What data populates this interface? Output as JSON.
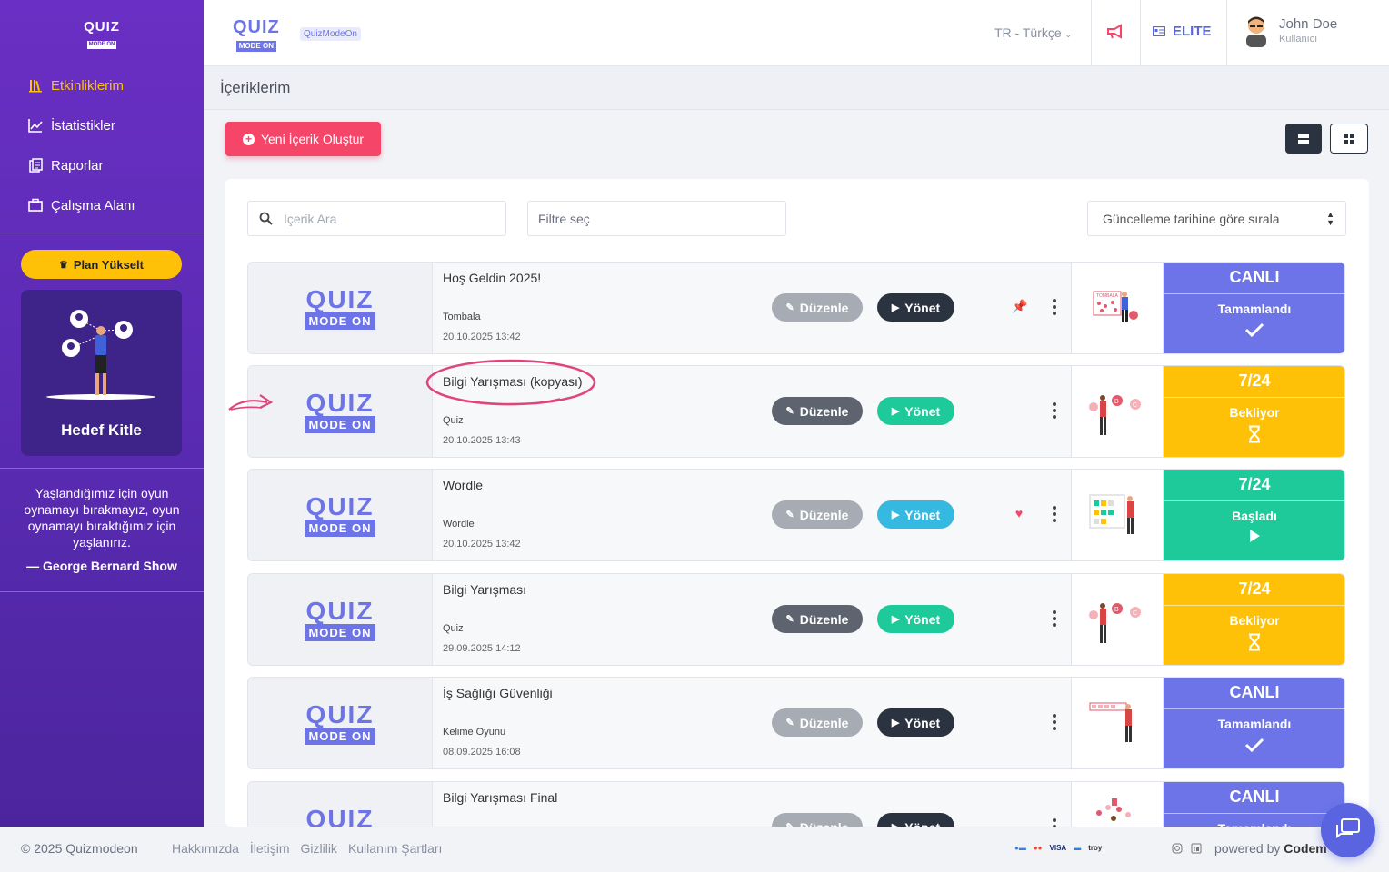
{
  "sidebar": {
    "logo": {
      "quiz": "QUIZ",
      "modeon": "MODE ON"
    },
    "items": [
      {
        "label": "Etkinliklerim",
        "icon": "library-icon",
        "active": true
      },
      {
        "label": "İstatistikler",
        "icon": "chart-line-icon"
      },
      {
        "label": "Raporlar",
        "icon": "reports-icon"
      },
      {
        "label": "Çalışma Alanı",
        "icon": "briefcase-icon"
      }
    ],
    "plan_button": "Plan Yükselt",
    "audience_card": "Hedef Kitle",
    "quote": "Yaşlandığımız için oyun oynamayı bırakmayız, oyun oynamayı bıraktığımız için yaşlanırız.",
    "quote_author": "— George Bernard Show"
  },
  "header": {
    "logo": {
      "quiz": "QUIZ",
      "modeon": "MODE ON"
    },
    "badge": "QuizModeOn",
    "language": "TR - Türkçe",
    "plan": "ELITE",
    "user_name": "John Doe",
    "user_role": "Kullanıcı"
  },
  "page_title": "İçeriklerim",
  "new_content_button": "Yeni İçerik Oluştur",
  "toolbar": {
    "search_placeholder": "İçerik Ara",
    "filter_placeholder": "Filtre seç",
    "sort_label": "Güncelleme tarihine göre sırala"
  },
  "colors": {
    "purple": "#6c74e8",
    "yellow": "#ffc107",
    "green": "#1ec99a",
    "pink": "#f5466a",
    "blue": "#5a63e0"
  },
  "rows": [
    {
      "title": "Hoş Geldin 2025!",
      "type": "Tombala",
      "date": "20.10.2025 13:42",
      "edit_label": "Düzenle",
      "manage_label": "Yönet",
      "edit_style": "gray",
      "manage_style": "dark",
      "mark": "pin",
      "status_top": "CANLI",
      "status_label": "Tamamlandı",
      "status_icon": "check",
      "status_color": "#6c74e8"
    },
    {
      "title": "Bilgi Yarışması (kopyası)",
      "type": "Quiz",
      "date": "20.10.2025 13:43",
      "edit_label": "Düzenle",
      "manage_label": "Yönet",
      "edit_style": "dark-gray",
      "manage_style": "green",
      "mark": "",
      "status_top": "7/24",
      "status_label": "Bekliyor",
      "status_icon": "hourglass",
      "status_color": "#ffc107"
    },
    {
      "title": "Wordle",
      "type": "Wordle",
      "date": "20.10.2025 13:42",
      "edit_label": "Düzenle",
      "manage_label": "Yönet",
      "edit_style": "gray",
      "manage_style": "cyan",
      "mark": "heart",
      "status_top": "7/24",
      "status_label": "Başladı",
      "status_icon": "play",
      "status_color": "#1ec99a"
    },
    {
      "title": "Bilgi Yarışması",
      "type": "Quiz",
      "date": "29.09.2025 14:12",
      "edit_label": "Düzenle",
      "manage_label": "Yönet",
      "edit_style": "dark-gray",
      "manage_style": "green",
      "mark": "",
      "status_top": "7/24",
      "status_label": "Bekliyor",
      "status_icon": "hourglass",
      "status_color": "#ffc107"
    },
    {
      "title": "İş Sağlığı Güvenliği",
      "type": "Kelime Oyunu",
      "date": "08.09.2025 16:08",
      "edit_label": "Düzenle",
      "manage_label": "Yönet",
      "edit_style": "gray",
      "manage_style": "dark",
      "mark": "",
      "status_top": "CANLI",
      "status_label": "Tamamlandı",
      "status_icon": "check",
      "status_color": "#6c74e8"
    },
    {
      "title": "Bilgi Yarışması Final",
      "type": "",
      "date": "",
      "edit_label": "Düzenle",
      "manage_label": "Yönet",
      "edit_style": "gray",
      "manage_style": "dark",
      "mark": "",
      "status_top": "CANLI",
      "status_label": "Tamamlandı",
      "status_icon": "",
      "status_color": "#6c74e8"
    }
  ],
  "footer": {
    "copyright": "© 2025 Quizmodeon",
    "links": [
      "Hakkımızda",
      "İletişim",
      "Gizlilik",
      "Kullanım Şartları"
    ],
    "powered": "powered by",
    "powered_brand": "Codem"
  }
}
